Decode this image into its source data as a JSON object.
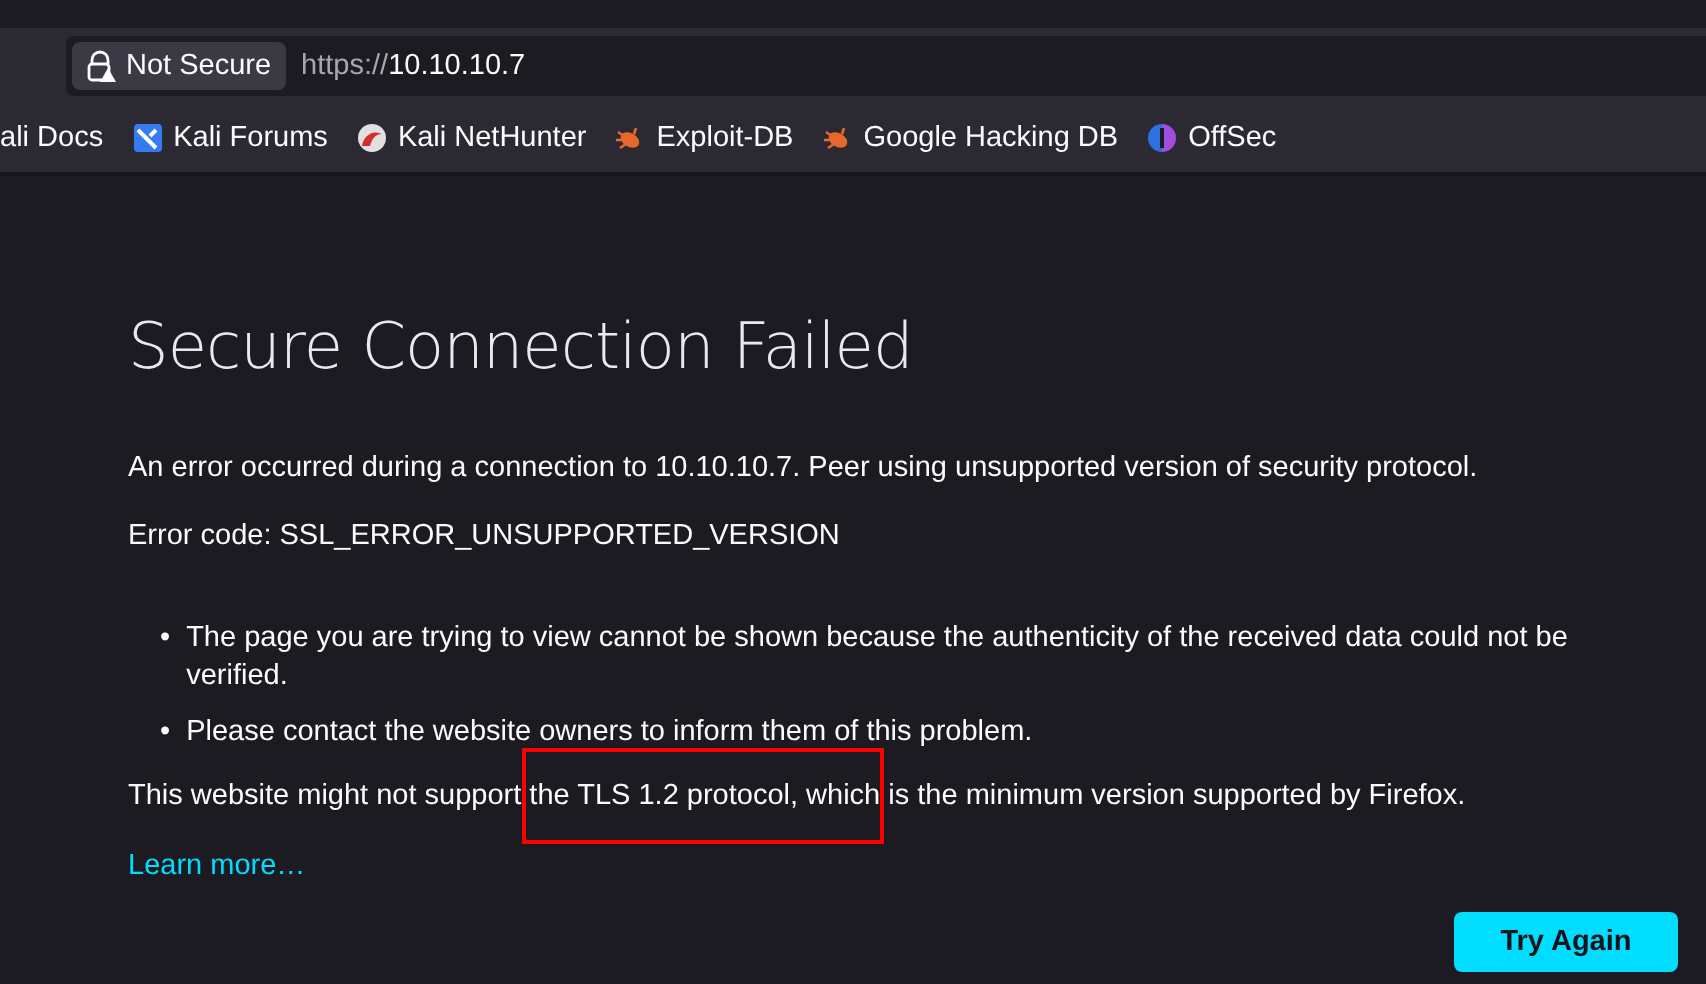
{
  "address_bar": {
    "security_label": "Not Secure",
    "url_scheme": "https://",
    "url_host": "10.10.10.7"
  },
  "bookmarks": [
    {
      "label": "ali Docs",
      "kind": "plain"
    },
    {
      "label": "Kali Forums",
      "kind": "forums"
    },
    {
      "label": "Kali NetHunter",
      "kind": "nethunter"
    },
    {
      "label": "Exploit-DB",
      "kind": "bug"
    },
    {
      "label": "Google Hacking DB",
      "kind": "bug"
    },
    {
      "label": "OffSec",
      "kind": "offsec"
    }
  ],
  "error_page": {
    "title": "Secure Connection Failed",
    "description": "An error occurred during a connection to 10.10.10.7. Peer using unsupported version of security protocol.",
    "error_code": "Error code: SSL_ERROR_UNSUPPORTED_VERSION",
    "bullets": [
      {
        "marker": "•",
        "text": "The page you are trying to view cannot be shown because the authenticity of the received data could not be verified."
      },
      {
        "marker": "•",
        "text": "Please contact the website owners to inform them of this problem."
      }
    ],
    "note": "This website might not support the TLS 1.2 protocol, which is the minimum version supported by Firefox.",
    "learn_more": "Learn more…",
    "button": "Try Again"
  }
}
